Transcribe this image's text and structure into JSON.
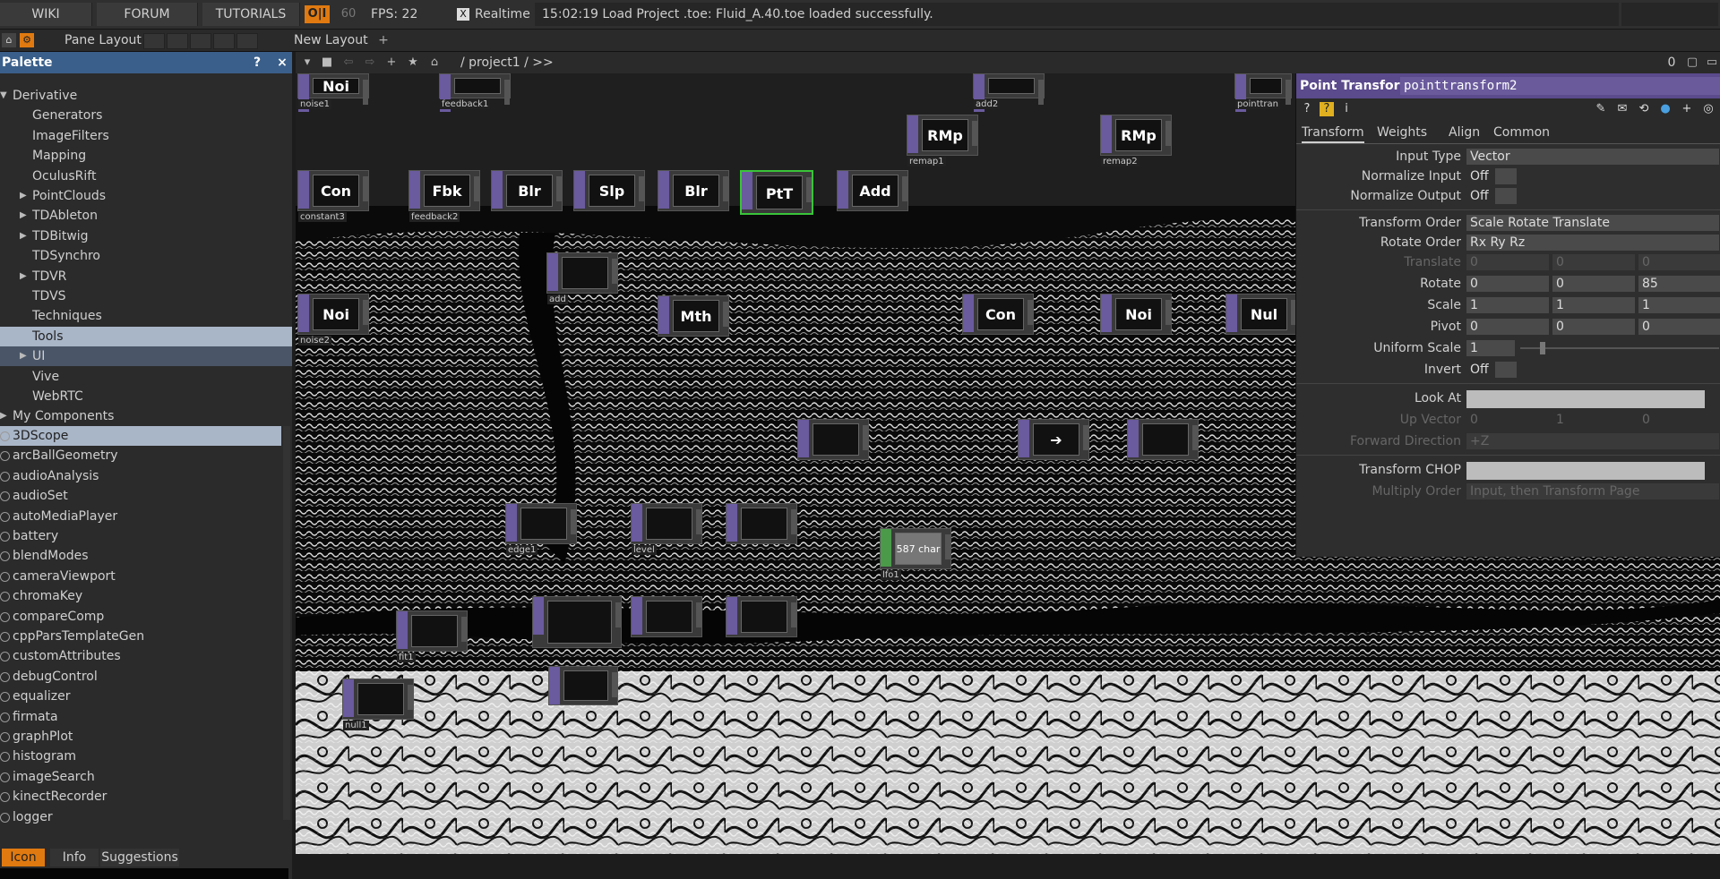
{
  "topbar": {
    "wiki": "WIKI",
    "forum": "FORUM",
    "tutorials": "TUTORIALS",
    "oi": "O|I",
    "sixty": "60",
    "fps": "FPS:  22",
    "realtime_check": "X",
    "realtime": "Realtime",
    "status": "15:02:19 Load Project .toe: Fluid_A.40.toe loaded successfully."
  },
  "bar2": {
    "pane_layout": "Pane Layout",
    "new_layout": "New Layout",
    "plus": "+"
  },
  "palette": {
    "title": "Palette",
    "help": "?",
    "close": "×",
    "tree": [
      {
        "label": "Derivative",
        "indent": 0,
        "arrow": "down"
      },
      {
        "label": "Generators",
        "indent": 2,
        "arrow": ""
      },
      {
        "label": "ImageFilters",
        "indent": 2,
        "arrow": ""
      },
      {
        "label": "Mapping",
        "indent": 2,
        "arrow": ""
      },
      {
        "label": "OculusRift",
        "indent": 2,
        "arrow": ""
      },
      {
        "label": "PointClouds",
        "indent": 2,
        "arrow": "right"
      },
      {
        "label": "TDAbleton",
        "indent": 2,
        "arrow": "right"
      },
      {
        "label": "TDBitwig",
        "indent": 2,
        "arrow": "right"
      },
      {
        "label": "TDSynchro",
        "indent": 2,
        "arrow": ""
      },
      {
        "label": "TDVR",
        "indent": 2,
        "arrow": "right"
      },
      {
        "label": "TDVS",
        "indent": 2,
        "arrow": ""
      },
      {
        "label": "Techniques",
        "indent": 2,
        "arrow": ""
      },
      {
        "label": "Tools",
        "indent": 2,
        "arrow": "",
        "selected": true
      },
      {
        "label": "UI",
        "indent": 2,
        "arrow": "right",
        "hover": true
      },
      {
        "label": "Vive",
        "indent": 2,
        "arrow": ""
      },
      {
        "label": "WebRTC",
        "indent": 2,
        "arrow": ""
      },
      {
        "label": "My Components",
        "indent": 0,
        "arrow": "right"
      }
    ],
    "items": [
      "3DScope",
      "arcBallGeometry",
      "audioAnalysis",
      "audioSet",
      "autoMediaPlayer",
      "battery",
      "blendModes",
      "cameraViewport",
      "chromaKey",
      "compareComp",
      "cppParsTemplateGen",
      "customAttributes",
      "debugControl",
      "equalizer",
      "firmata",
      "graphPlot",
      "histogram",
      "imageSearch",
      "kinectRecorder",
      "logger"
    ],
    "tabs": [
      "Icon",
      "Info",
      "Suggestions"
    ]
  },
  "network": {
    "path": "/ project1 / >>",
    "zero": "0",
    "nodes": [
      {
        "label": "Noi",
        "name": "noise1"
      },
      {
        "label": "",
        "name": "feedback1"
      },
      {
        "label": "",
        "name": "add2"
      },
      {
        "label": "",
        "name": "pointtran"
      },
      {
        "label": "RMp",
        "name": "remap1"
      },
      {
        "label": "RMp",
        "name": "remap2"
      },
      {
        "label": "Con",
        "name": "constant3"
      },
      {
        "label": "Fbk",
        "name": "feedback2"
      },
      {
        "label": "Blr",
        "name": ""
      },
      {
        "label": "Slp",
        "name": ""
      },
      {
        "label": "Blr",
        "name": ""
      },
      {
        "label": "PtT",
        "name": ""
      },
      {
        "label": "Add",
        "name": ""
      },
      {
        "label": "",
        "name": "add"
      },
      {
        "label": "Mth",
        "name": ""
      },
      {
        "label": "Noi",
        "name": "noise2"
      },
      {
        "label": "Con",
        "name": ""
      },
      {
        "label": "Noi",
        "name": ""
      },
      {
        "label": "Nul",
        "name": ""
      },
      {
        "label": "",
        "name": ""
      },
      {
        "label": "➔",
        "name": ""
      },
      {
        "label": "",
        "name": ""
      },
      {
        "label": "",
        "name": "edge1"
      },
      {
        "label": "",
        "name": "level"
      },
      {
        "label": "",
        "name": ""
      },
      {
        "label": "587 char",
        "name": "lfo1"
      },
      {
        "label": "",
        "name": "fit1"
      },
      {
        "label": "",
        "name": ""
      },
      {
        "label": "",
        "name": ""
      },
      {
        "label": "",
        "name": ""
      },
      {
        "label": "",
        "name": ""
      },
      {
        "label": "",
        "name": "null1"
      }
    ]
  },
  "params": {
    "op_type": "Point Transform",
    "op_name": "pointtransform2",
    "tabs": [
      "Transform",
      "Weights",
      "Align",
      "Common"
    ],
    "input_type_label": "Input Type",
    "input_type": "Vector",
    "normalize_input_label": "Normalize Input",
    "normalize_input": "Off",
    "normalize_output_label": "Normalize Output",
    "normalize_output": "Off",
    "transform_order_label": "Transform Order",
    "transform_order": "Scale Rotate Translate",
    "rotate_order_label": "Rotate Order",
    "rotate_order": "Rx Ry Rz",
    "translate_label": "Translate",
    "translate": [
      "0",
      "0",
      "0"
    ],
    "rotate_label": "Rotate",
    "rotate": [
      "0",
      "0",
      "85"
    ],
    "scale_label": "Scale",
    "scale": [
      "1",
      "1",
      "1"
    ],
    "pivot_label": "Pivot",
    "pivot": [
      "0",
      "0",
      "0"
    ],
    "uniform_scale_label": "Uniform Scale",
    "uniform_scale": "1",
    "invert_label": "Invert",
    "invert": "Off",
    "look_at_label": "Look At",
    "up_vector_label": "Up Vector",
    "up_vector": [
      "0",
      "1",
      "0"
    ],
    "forward_direction_label": "Forward Direction",
    "forward_direction": "+Z",
    "transform_chop_label": "Transform CHOP",
    "multiply_order_label": "Multiply Order",
    "multiply_order": "Input, then Transform Page"
  }
}
